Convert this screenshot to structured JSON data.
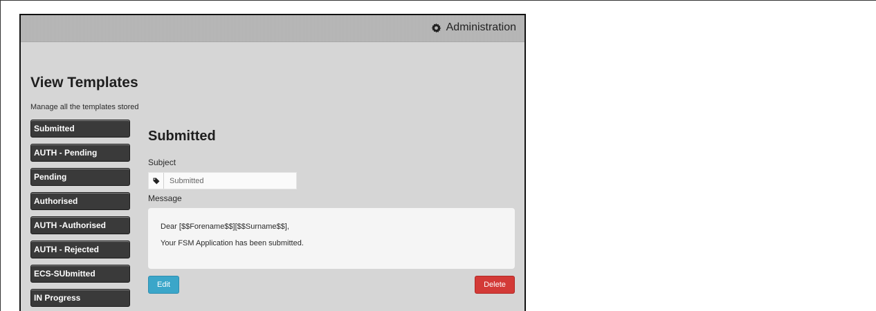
{
  "header": {
    "admin_label": "Administration",
    "admin_icon": "gear-icon"
  },
  "page": {
    "title": "View Templates",
    "subtitle": "Manage all the templates stored"
  },
  "sidebar": {
    "items": [
      {
        "label": "Submitted"
      },
      {
        "label": "AUTH - Pending"
      },
      {
        "label": "Pending"
      },
      {
        "label": "Authorised"
      },
      {
        "label": "AUTH -Authorised"
      },
      {
        "label": "AUTH - Rejected"
      },
      {
        "label": "ECS-SUbmitted"
      },
      {
        "label": "IN Progress"
      }
    ]
  },
  "detail": {
    "title": "Submitted",
    "subject_label": "Subject",
    "subject_value": "Submitted",
    "subject_icon": "tag-icon",
    "message_label": "Message",
    "message_lines": [
      "Dear [$$Forename$$][$$Surname$$],",
      "Your FSM Application has been submitted."
    ],
    "edit_label": "Edit",
    "delete_label": "Delete"
  },
  "colors": {
    "edit_button": "#3ba6c9",
    "delete_button": "#d33a37",
    "sidebar_button": "#3a3a3a",
    "panel_background": "#d6d6d6"
  }
}
